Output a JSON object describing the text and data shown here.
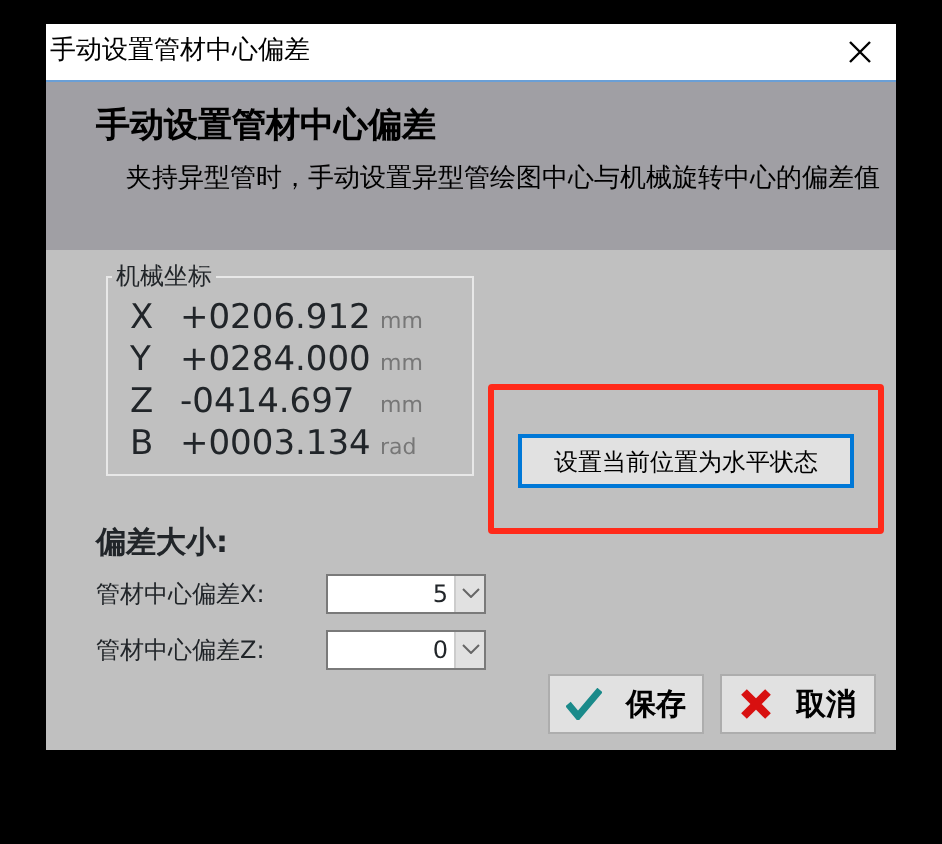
{
  "window": {
    "title": "手动设置管材中心偏差"
  },
  "header": {
    "title": "手动设置管材中心偏差",
    "subtitle": "夹持异型管时，手动设置异型管绘图中心与机械旋转中心的偏差值"
  },
  "coordinates": {
    "title": "机械坐标",
    "axes": [
      {
        "axis": "X",
        "value": "+0206.912",
        "unit": "mm"
      },
      {
        "axis": "Y",
        "value": "+0284.000",
        "unit": "mm"
      },
      {
        "axis": "Z",
        "value": "-0414.697",
        "unit": "mm"
      },
      {
        "axis": "B",
        "value": "+0003.134",
        "unit": "rad"
      }
    ]
  },
  "level_button": {
    "label": "设置当前位置为水平状态"
  },
  "offset": {
    "heading": "偏差大小:",
    "fields": [
      {
        "label": "管材中心偏差X:",
        "value": "5"
      },
      {
        "label": "管材中心偏差Z:",
        "value": "0"
      }
    ]
  },
  "buttons": [
    {
      "kind": "save",
      "label": "保存"
    },
    {
      "kind": "cancel",
      "label": "取消"
    }
  ]
}
